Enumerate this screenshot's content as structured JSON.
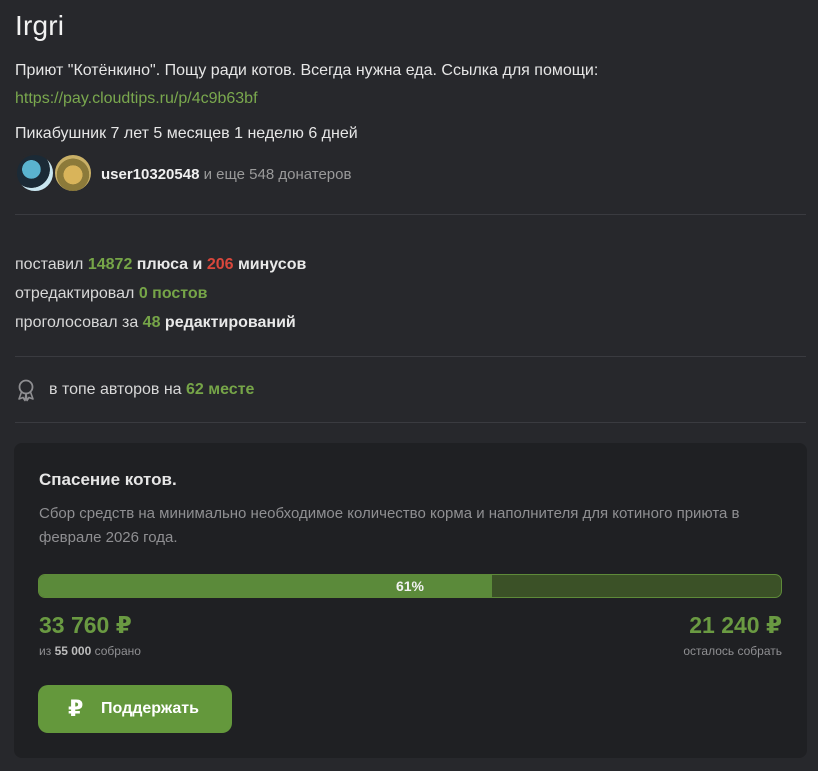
{
  "profile": {
    "username": "Irgri",
    "bio": "Приют \"Котёнкино\". Пощу ради котов. Всегда нужна еда. Ссылка для помощи:",
    "bio_link": "https://pay.cloudtips.ru/p/4c9b63bf",
    "tenure": "Пикабушник 7 лет 5 месяцев 1 неделю 6 дней"
  },
  "donors": {
    "top_user": "user10320548",
    "rest": "и еще 548 донатеров"
  },
  "stats": {
    "line1_prefix": "поставил",
    "pluses": "14872",
    "line1_mid": "плюса и",
    "minuses": "206",
    "line1_suffix": "минусов",
    "line2_prefix": "отредактировал",
    "edited": "0 постов",
    "line3_prefix": "проголосовал за",
    "votes": "48",
    "line3_suffix": "редактирований"
  },
  "rank": {
    "icon": "award-icon",
    "prefix": "в топе авторов на",
    "place": "62 месте"
  },
  "fundraiser": {
    "title": "Спасение котов.",
    "description": "Сбор средств на минимально необходимое количество корма и наполнителя для котиного приюта в феврале 2026 года.",
    "progress_percent": 61,
    "progress_label": "61%",
    "raised": "33 760 ₽",
    "raised_sub_prefix": "из",
    "goal": "55 000",
    "raised_sub_suffix": "собрано",
    "remaining": "21 240 ₽",
    "remaining_sub": "осталось собрать",
    "button_icon": "₽",
    "button_label": "Поддержать"
  },
  "colors": {
    "background": "#27282c",
    "card": "#1f2023",
    "accent_green": "#64983c",
    "link_green": "#7aa84e",
    "minus_red": "#d9473c"
  }
}
